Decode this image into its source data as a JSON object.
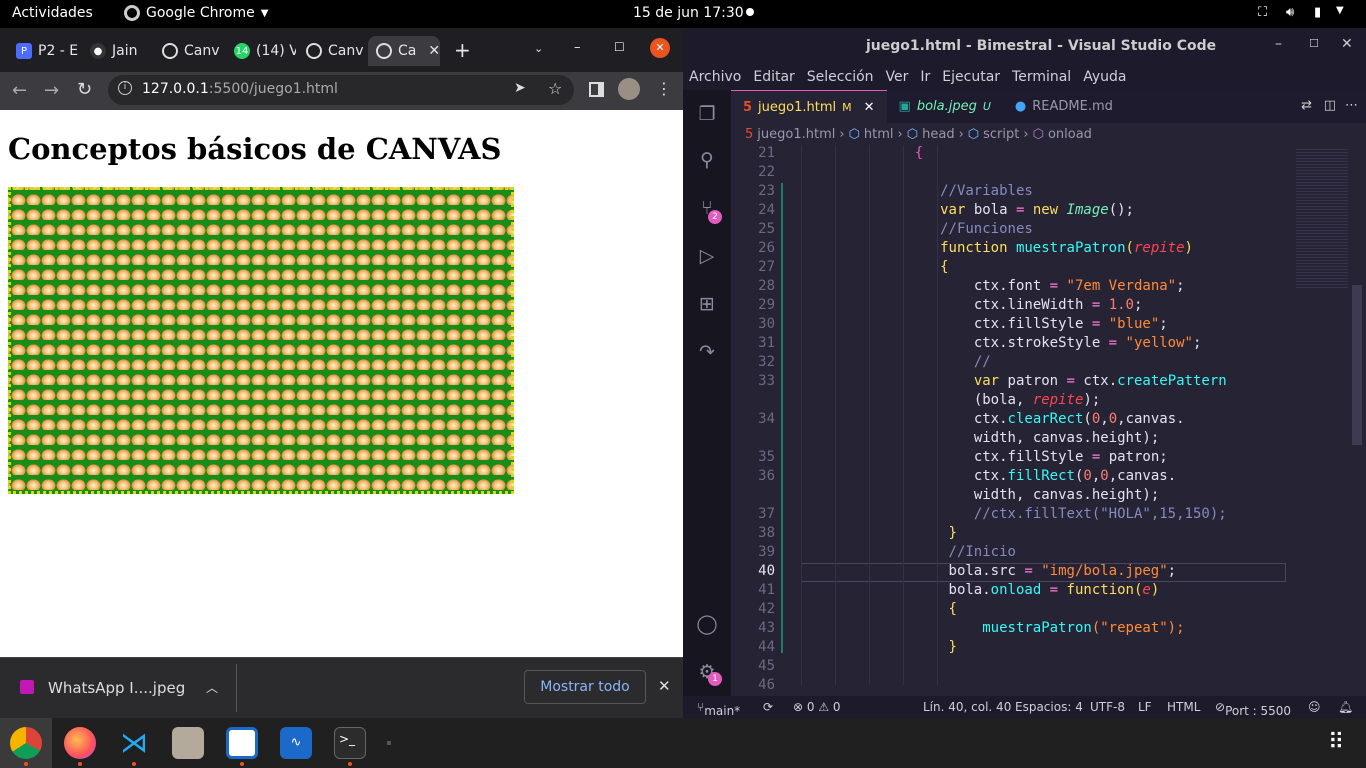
{
  "topbar": {
    "activities": "Actividades",
    "app": "Google Chrome",
    "clock": "15 de jun  17:30"
  },
  "chrome": {
    "tabs": [
      "P2 - E",
      "Jain",
      "Canv",
      "(14) V",
      "Canv",
      "Ca"
    ],
    "whatsapp_badge": "14",
    "url_host": "127.0.0.1",
    "url_rest": ":5500/juego1.html",
    "page_heading": "Conceptos básicos de CANVAS",
    "download": {
      "file": "WhatsApp I....jpeg",
      "show_all": "Mostrar todo"
    }
  },
  "vscode": {
    "title": "juego1.html - Bimestral - Visual Studio Code",
    "menu": [
      "Archivo",
      "Editar",
      "Selección",
      "Ver",
      "Ir",
      "Ejecutar",
      "Terminal",
      "Ayuda"
    ],
    "tabs": [
      {
        "name": "juego1.html",
        "flag": "M"
      },
      {
        "name": "bola.jpeg",
        "flag": "U"
      },
      {
        "name": "README.md",
        "flag": ""
      }
    ],
    "breadcrumb": [
      "juego1.html",
      "html",
      "head",
      "script",
      "onload"
    ],
    "scm_badge": "2",
    "account_badge": "1",
    "status": {
      "branch": "main*",
      "problems": "⊗ 0 ⚠ 0",
      "position": "Lín. 40, col. 40",
      "spaces": "Espacios: 4",
      "encoding": "UTF-8",
      "eol": "LF",
      "lang": "HTML",
      "port": "Port : 5500"
    },
    "lines": [
      {
        "n": "21",
        "i": 13.5,
        "t": [
          [
            "{",
            "c-pink"
          ]
        ]
      },
      {
        "n": "22",
        "i": 0,
        "t": []
      },
      {
        "n": "23",
        "i": 16.5,
        "t": [
          [
            "//Variables",
            "c-com"
          ]
        ]
      },
      {
        "n": "24",
        "i": 16.5,
        "t": [
          [
            "var ",
            "c-kw"
          ],
          [
            "bola ",
            ""
          ],
          [
            "= ",
            "c-prop"
          ],
          [
            "new ",
            "c-kw"
          ],
          [
            "Image",
            "c-it"
          ],
          [
            "();",
            ""
          ]
        ]
      },
      {
        "n": "25",
        "i": 16.5,
        "t": [
          [
            "//Funciones",
            "c-com"
          ]
        ]
      },
      {
        "n": "26",
        "i": 16.5,
        "t": [
          [
            "function ",
            "c-kw"
          ],
          [
            "muestraPatron",
            "c-fn"
          ],
          [
            "(",
            "c-kw"
          ],
          [
            "repite",
            "c-par"
          ],
          [
            ")",
            "c-kw"
          ]
        ]
      },
      {
        "n": "27",
        "i": 16.5,
        "t": [
          [
            "{",
            "c-kw"
          ]
        ]
      },
      {
        "n": "28",
        "i": 20.5,
        "t": [
          [
            "ctx.font ",
            ""
          ],
          [
            "= ",
            "c-prop"
          ],
          [
            "\"7em Verdana\"",
            "c-str"
          ],
          [
            ";",
            ""
          ]
        ]
      },
      {
        "n": "29",
        "i": 20.5,
        "t": [
          [
            "ctx.lineWidth ",
            ""
          ],
          [
            "= ",
            "c-prop"
          ],
          [
            "1.0",
            "c-num"
          ],
          [
            ";",
            ""
          ]
        ]
      },
      {
        "n": "30",
        "i": 20.5,
        "t": [
          [
            "ctx.fillStyle ",
            ""
          ],
          [
            "= ",
            "c-prop"
          ],
          [
            "\"blue\"",
            "c-str"
          ],
          [
            ";",
            ""
          ]
        ]
      },
      {
        "n": "31",
        "i": 20.5,
        "t": [
          [
            "ctx.strokeStyle ",
            ""
          ],
          [
            "= ",
            "c-prop"
          ],
          [
            "\"yellow\"",
            "c-str"
          ],
          [
            ";",
            ""
          ]
        ]
      },
      {
        "n": "32",
        "i": 20.5,
        "t": [
          [
            "//",
            "c-com"
          ]
        ]
      },
      {
        "n": "33",
        "i": 20.5,
        "t": [
          [
            "var ",
            "c-kw"
          ],
          [
            "patron ",
            ""
          ],
          [
            "= ",
            "c-prop"
          ],
          [
            "ctx.",
            ""
          ],
          [
            "createPattern",
            "c-fn"
          ]
        ]
      },
      {
        "n": "",
        "i": 20.5,
        "t": [
          [
            "(bola, ",
            ""
          ],
          [
            "repite",
            "c-par"
          ],
          [
            ");",
            ""
          ]
        ]
      },
      {
        "n": "34",
        "i": 20.5,
        "t": [
          [
            "ctx.",
            ""
          ],
          [
            "clearRect",
            "c-fn"
          ],
          [
            "(",
            ""
          ],
          [
            "0",
            "c-num"
          ],
          [
            ",",
            ""
          ],
          [
            "0",
            "c-num"
          ],
          [
            ",canvas.",
            ""
          ]
        ]
      },
      {
        "n": "",
        "i": 20.5,
        "t": [
          [
            "width, canvas.height);",
            ""
          ]
        ]
      },
      {
        "n": "35",
        "i": 20.5,
        "t": [
          [
            "ctx.fillStyle ",
            ""
          ],
          [
            "= ",
            "c-prop"
          ],
          [
            "patron;",
            ""
          ]
        ]
      },
      {
        "n": "36",
        "i": 20.5,
        "t": [
          [
            "ctx.",
            ""
          ],
          [
            "fillRect",
            "c-fn"
          ],
          [
            "(",
            ""
          ],
          [
            "0",
            "c-num"
          ],
          [
            ",",
            ""
          ],
          [
            "0",
            "c-num"
          ],
          [
            ",canvas.",
            ""
          ]
        ]
      },
      {
        "n": "",
        "i": 20.5,
        "t": [
          [
            "width, canvas.height);",
            ""
          ]
        ]
      },
      {
        "n": "37",
        "i": 20.5,
        "t": [
          [
            "//ctx.fillText(\"HOLA\",15,150);",
            "c-com"
          ]
        ]
      },
      {
        "n": "38",
        "i": 17.5,
        "t": [
          [
            "}",
            "c-kw"
          ]
        ]
      },
      {
        "n": "39",
        "i": 17.5,
        "t": [
          [
            "//Inicio",
            "c-com"
          ]
        ]
      },
      {
        "n": "40",
        "i": 17.5,
        "t": [
          [
            "bola.src ",
            ""
          ],
          [
            "= ",
            "c-prop"
          ],
          [
            "\"img/bola.jpeg\"",
            "c-str"
          ],
          [
            ";",
            ""
          ]
        ]
      },
      {
        "n": "41",
        "i": 17.5,
        "t": [
          [
            "bola.",
            ""
          ],
          [
            "onload",
            "c-fn"
          ],
          [
            " = ",
            "c-prop"
          ],
          [
            "function",
            "c-kw"
          ],
          [
            "(",
            "c-kw"
          ],
          [
            "e",
            "c-par"
          ],
          [
            ")",
            "c-kw"
          ]
        ]
      },
      {
        "n": "42",
        "i": 17.5,
        "t": [
          [
            "{",
            "c-kw"
          ]
        ]
      },
      {
        "n": "43",
        "i": 21.5,
        "t": [
          [
            "muestraPatron",
            "c-fn"
          ],
          [
            "(\"repeat\");",
            "c-str"
          ]
        ]
      },
      {
        "n": "44",
        "i": 17.5,
        "t": [
          [
            "}",
            "c-kw"
          ]
        ]
      },
      {
        "n": "45",
        "i": 0,
        "t": []
      },
      {
        "n": "46",
        "i": 0,
        "t": []
      }
    ]
  }
}
